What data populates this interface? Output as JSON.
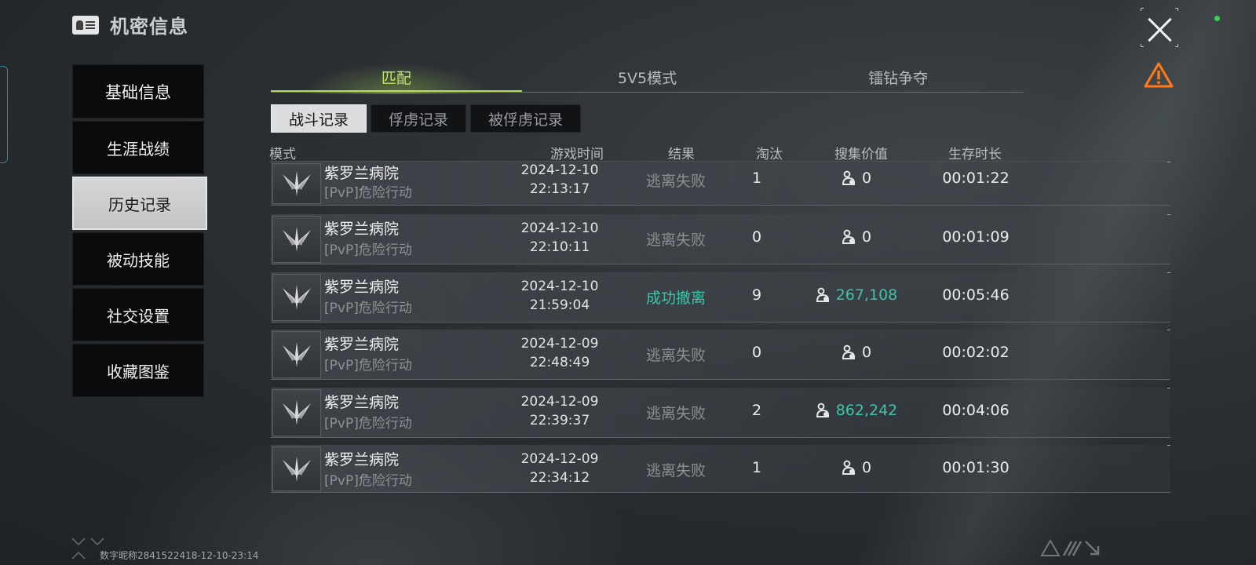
{
  "header": {
    "title": "机密信息",
    "icon": "id-card-icon"
  },
  "controls": {
    "close_icon": "close-icon",
    "warning_icon": "warning-icon"
  },
  "sidebar": {
    "items": [
      {
        "label": "基础信息"
      },
      {
        "label": "生涯战绩"
      },
      {
        "label": "历史记录",
        "active": true
      },
      {
        "label": "被动技能"
      },
      {
        "label": "社交设置"
      },
      {
        "label": "收藏图鉴"
      }
    ]
  },
  "tabs": [
    {
      "label": "匹配",
      "active": true
    },
    {
      "label": "5V5模式"
    },
    {
      "label": "镭钻争夺"
    }
  ],
  "subtabs": [
    {
      "label": "战斗记录",
      "active": true
    },
    {
      "label": "俘虏记录"
    },
    {
      "label": "被俘虏记录"
    }
  ],
  "table": {
    "columns": {
      "mode": "模式",
      "time": "游戏时间",
      "result": "结果",
      "kills": "淘汰",
      "value": "搜集价值",
      "survival": "生存时长"
    },
    "rows": [
      {
        "map": "紫罗兰病院",
        "sub": "[PvP]危险行动",
        "date": "2024-12-10",
        "clock": "22:13:17",
        "result": "逃离失败",
        "kills": "1",
        "value": "0",
        "survival": "00:01:22"
      },
      {
        "map": "紫罗兰病院",
        "sub": "[PvP]危险行动",
        "date": "2024-12-10",
        "clock": "22:10:11",
        "result": "逃离失败",
        "kills": "0",
        "value": "0",
        "survival": "00:01:09"
      },
      {
        "map": "紫罗兰病院",
        "sub": "[PvP]危险行动",
        "date": "2024-12-10",
        "clock": "21:59:04",
        "result": "成功撤离",
        "kills": "9",
        "value": "267,108",
        "survival": "00:05:46"
      },
      {
        "map": "紫罗兰病院",
        "sub": "[PvP]危险行动",
        "date": "2024-12-09",
        "clock": "22:48:49",
        "result": "逃离失败",
        "kills": "0",
        "value": "0",
        "survival": "00:02:02"
      },
      {
        "map": "紫罗兰病院",
        "sub": "[PvP]危险行动",
        "date": "2024-12-09",
        "clock": "22:39:37",
        "result": "逃离失败",
        "kills": "2",
        "value": "862,242",
        "survival": "00:04:06"
      },
      {
        "map": "紫罗兰病院",
        "sub": "[PvP]危险行动",
        "date": "2024-12-09",
        "clock": "22:34:12",
        "result": "逃离失败",
        "kills": "1",
        "value": "0",
        "survival": "00:01:30"
      }
    ]
  },
  "footer": {
    "id_text": "数字昵称2841522418-12-10-23:14"
  },
  "colors": {
    "accent_green": "#c8e66a",
    "success": "#3fc3a8",
    "fail": "#8c9094"
  }
}
